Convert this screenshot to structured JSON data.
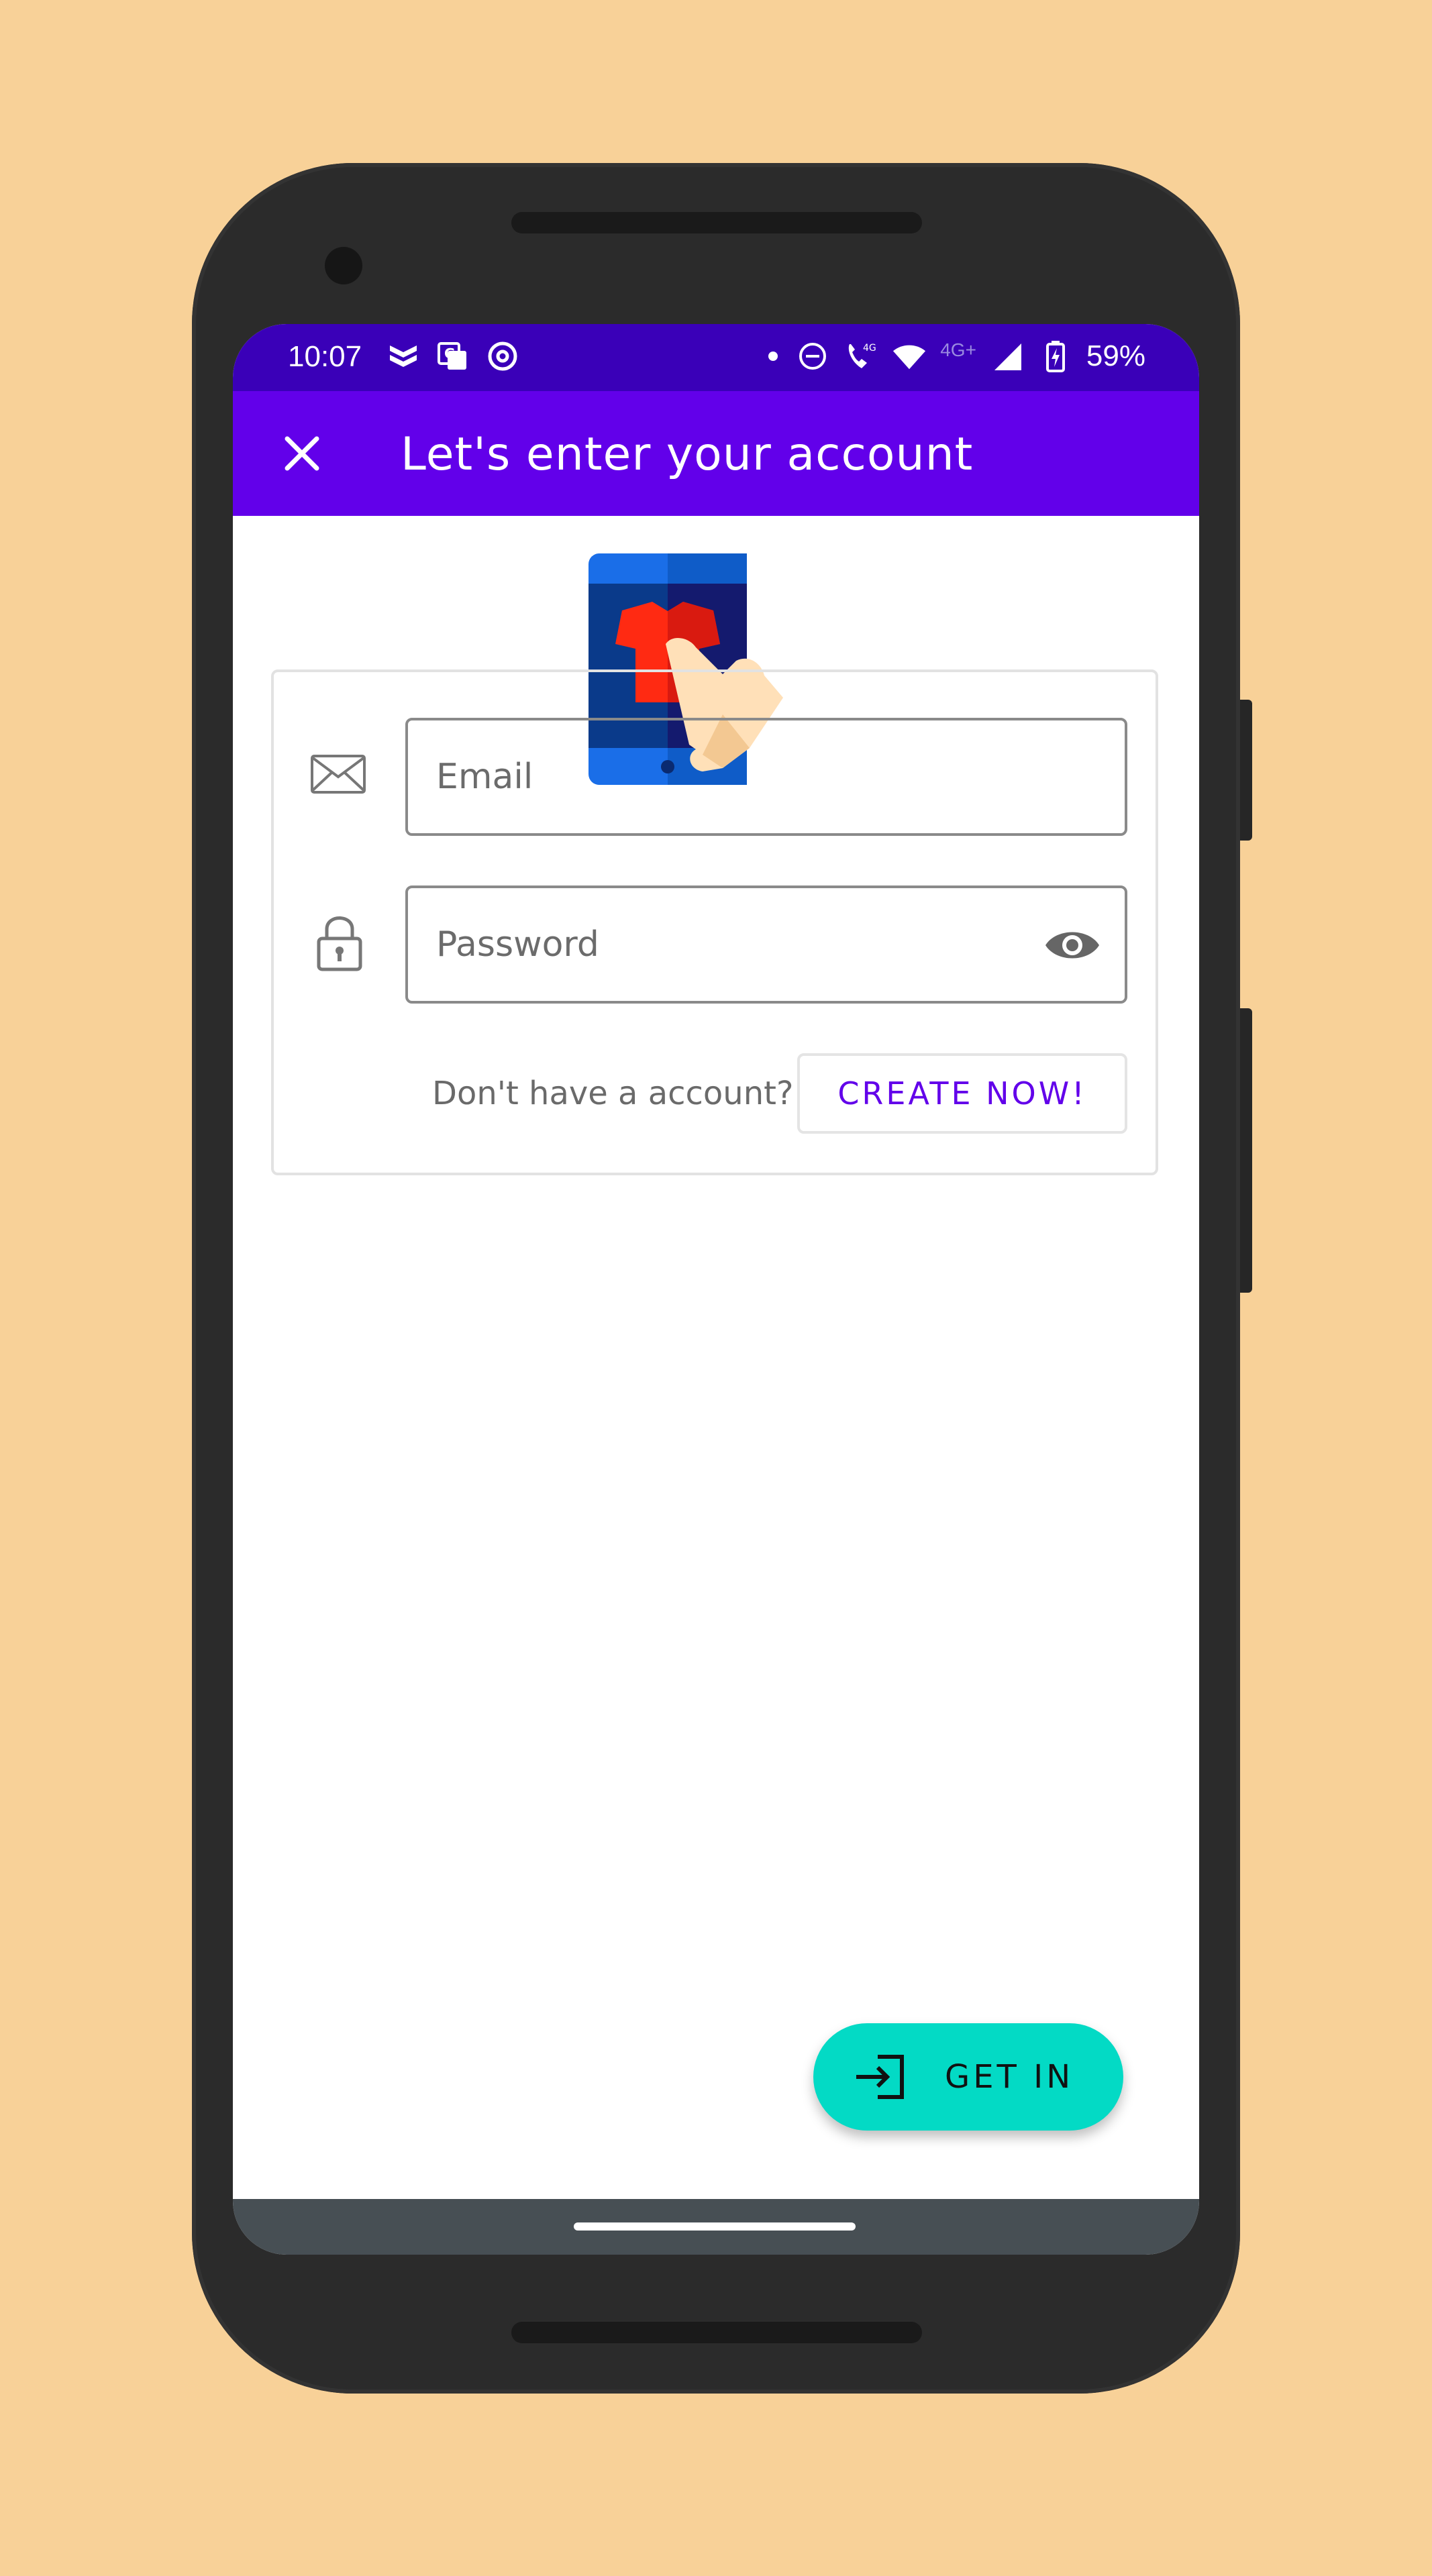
{
  "status_bar": {
    "time": "10:07",
    "network_label": "4G+",
    "battery": "59%"
  },
  "app_bar": {
    "title": "Let's enter your account",
    "close_icon": "close-icon"
  },
  "form": {
    "email_placeholder": "Email",
    "email_value": "",
    "password_placeholder": "Password",
    "password_value": "",
    "signup_hint": "Don't have a account?",
    "create_button": "CREATE NOW!"
  },
  "fab": {
    "label": "GET IN",
    "icon": "login-icon"
  },
  "colors": {
    "background": "#f8d198",
    "status_bar": "#3a00b8",
    "app_bar": "#6200ea",
    "accent": "#03dac5"
  }
}
